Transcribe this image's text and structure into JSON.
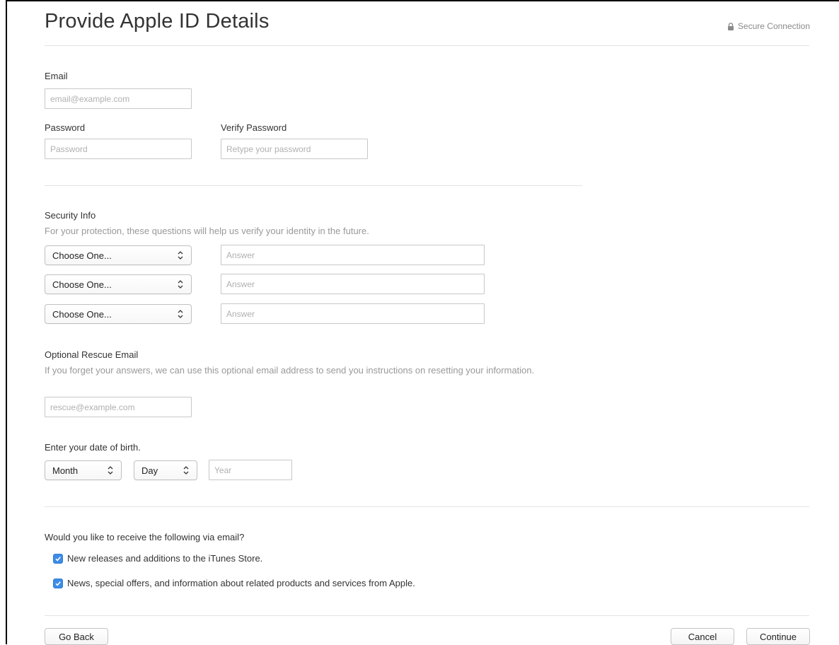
{
  "header": {
    "title": "Provide Apple ID Details",
    "secure_label": "Secure Connection"
  },
  "account": {
    "email_label": "Email",
    "email_placeholder": "email@example.com",
    "password_label": "Password",
    "password_placeholder": "Password",
    "verify_label": "Verify Password",
    "verify_placeholder": "Retype your password"
  },
  "security": {
    "heading": "Security Info",
    "description": "For your protection, these questions will help us verify your identity in the future.",
    "questions": [
      {
        "select": "Choose One...",
        "answer_placeholder": "Answer"
      },
      {
        "select": "Choose One...",
        "answer_placeholder": "Answer"
      },
      {
        "select": "Choose One...",
        "answer_placeholder": "Answer"
      }
    ]
  },
  "rescue": {
    "heading": "Optional Rescue Email",
    "description": "If you forget your answers, we can use this optional email address to send you instructions on resetting your information.",
    "placeholder": "rescue@example.com"
  },
  "birth": {
    "heading": "Enter your date of birth.",
    "month": "Month",
    "day": "Day",
    "year_placeholder": "Year"
  },
  "newsletter": {
    "question": "Would you like to receive the following via email?",
    "options": [
      {
        "label": "New releases and additions to the iTunes Store.",
        "checked": true
      },
      {
        "label": "News, special offers, and information about related products and services from Apple.",
        "checked": true
      }
    ]
  },
  "footer": {
    "back": "Go Back",
    "cancel": "Cancel",
    "continue": "Continue"
  },
  "colors": {
    "checkbox": "#3d8ce7",
    "divider": "#e3e3e3",
    "muted_text": "#999999"
  }
}
